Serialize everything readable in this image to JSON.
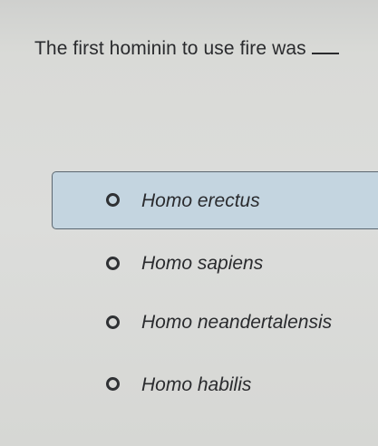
{
  "question": {
    "text": "The first hominin to use fire was"
  },
  "options": [
    {
      "label": "Homo erectus",
      "selected": true
    },
    {
      "label": "Homo sapiens",
      "selected": false
    },
    {
      "label": "Homo neandertalensis",
      "selected": false
    },
    {
      "label": "Homo habilis",
      "selected": false
    }
  ],
  "colors": {
    "background": "#d8d9d6",
    "selected_highlight": "#c4d5e0",
    "text": "#2a2b2e"
  }
}
